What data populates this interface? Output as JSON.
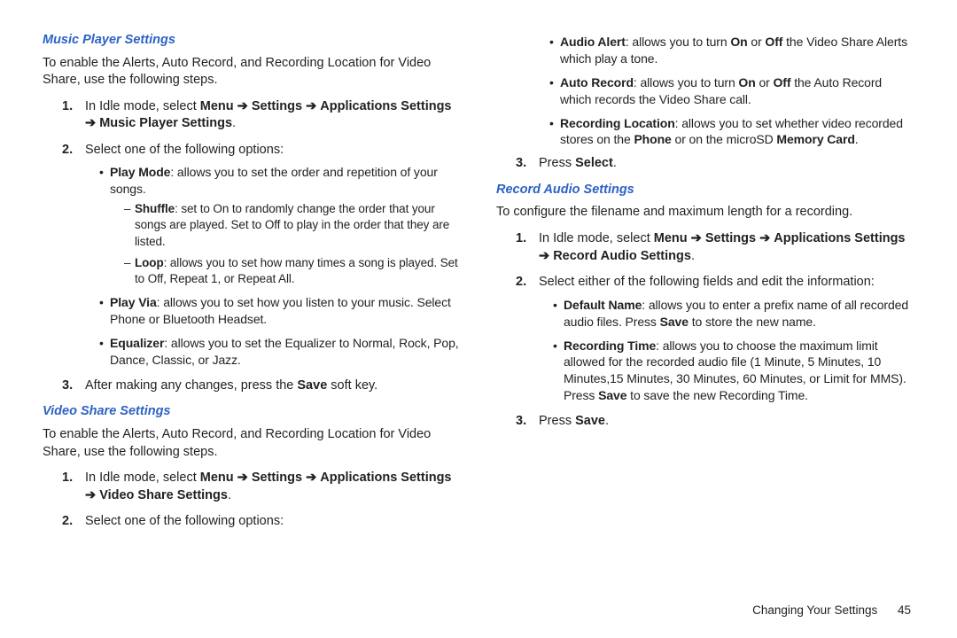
{
  "arrow": "➔",
  "left": {
    "music": {
      "heading": "Music Player Settings",
      "intro": "To enable the Alerts, Auto Record, and Recording Location for Video Share, use the following steps.",
      "step1_a": "In Idle mode, select ",
      "step1_b": "Menu",
      "step1_c": "Settings",
      "step1_d": "Applications Settings",
      "step1_e": "Music Player Settings",
      "step2": "Select one of the following options:",
      "play_mode_label": "Play Mode",
      "play_mode_text": ": allows you to set the order and repetition of your songs.",
      "shuffle_label": "Shuffle",
      "shuffle_text": ": set to On to randomly change the order that your songs are played. Set to Off to play in the order that they are listed.",
      "loop_label": "Loop",
      "loop_text": ": allows you to set how many times a song is played. Set to Off, Repeat 1, or Repeat All.",
      "play_via_label": "Play Via",
      "play_via_text": ": allows you to set how you listen to your music. Select Phone or Bluetooth Headset.",
      "eq_label": "Equalizer",
      "eq_text": ": allows you to set the Equalizer to Normal, Rock, Pop, Dance, Classic, or Jazz.",
      "step3_a": "After making any changes, press the ",
      "step3_b": "Save",
      "step3_c": " soft key."
    },
    "video": {
      "heading": "Video Share Settings",
      "intro": "To enable the Alerts, Auto Record, and Recording Location for Video Share, use the following steps.",
      "step1_a": "In Idle mode, select ",
      "step1_b": "Menu",
      "step1_c": "Settings",
      "step1_d": "Applications Settings",
      "step1_e": "Video Share Settings",
      "step2": "Select one of the following options:"
    }
  },
  "right": {
    "vs": {
      "audio_alert_label": "Audio Alert",
      "audio_alert_a": ": allows you to turn ",
      "audio_alert_on": "On",
      "audio_alert_b": " or ",
      "audio_alert_off": "Off",
      "audio_alert_c": " the Video Share Alerts which play a tone.",
      "auto_record_label": "Auto Record",
      "auto_record_a": ": allows you to turn ",
      "auto_record_on": "On",
      "auto_record_b": " or ",
      "auto_record_off": "Off",
      "auto_record_c": " the Auto Record which records the Video Share call.",
      "rec_loc_label": "Recording Location",
      "rec_loc_a": ": allows you to set whether video recorded stores on the ",
      "rec_loc_phone": "Phone",
      "rec_loc_b": " or on the microSD ",
      "rec_loc_card": "Memory Card",
      "rec_loc_c": ".",
      "step3_a": "Press ",
      "step3_b": "Select",
      "step3_c": "."
    },
    "record": {
      "heading": "Record Audio Settings",
      "intro": "To configure the filename and maximum length for a recording.",
      "step1_a": "In Idle mode, select ",
      "step1_b": "Menu",
      "step1_c": "Settings",
      "step1_d": "Applications Settings",
      "step1_e": "Record Audio Settings",
      "step2": "Select either of the following fields and edit the information:",
      "def_label": "Default Name",
      "def_a": ": allows you to enter a prefix name of all recorded audio files. Press ",
      "def_b": "Save",
      "def_c": " to store the new name.",
      "rt_label": "Recording Time",
      "rt_a": ": allows you to choose the maximum limit allowed for the recorded audio file (1 Minute, 5 Minutes, 10 Minutes,15 Minutes, 30 Minutes, 60 Minutes, or Limit for MMS). Press ",
      "rt_b": "Save",
      "rt_c": " to save the new Recording Time.",
      "step3_a": "Press ",
      "step3_b": "Save",
      "step3_c": "."
    }
  },
  "footer": {
    "section": "Changing Your Settings",
    "page": "45"
  }
}
